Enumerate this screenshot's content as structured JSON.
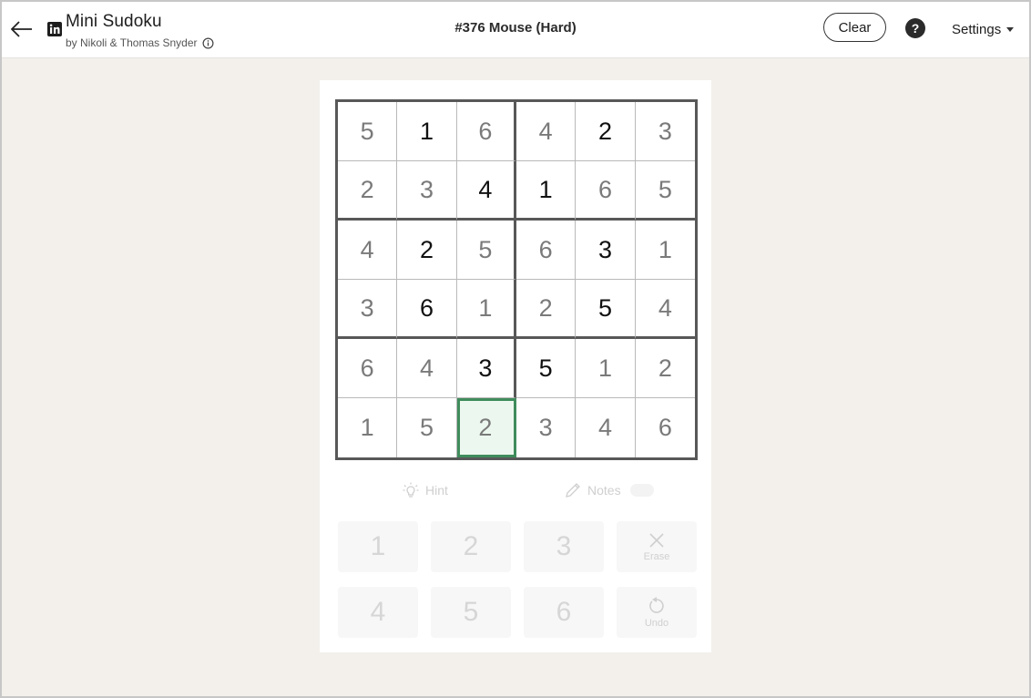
{
  "header": {
    "title": "Mini Sudoku",
    "byline": "by Nikoli & Thomas Snyder",
    "puzzle_title": "#376 Mouse (Hard)",
    "clear_label": "Clear",
    "help_label": "?",
    "settings_label": "Settings"
  },
  "board": {
    "rows": [
      [
        {
          "v": "5",
          "given": false
        },
        {
          "v": "1",
          "given": true
        },
        {
          "v": "6",
          "given": false
        },
        {
          "v": "4",
          "given": false
        },
        {
          "v": "2",
          "given": true
        },
        {
          "v": "3",
          "given": false
        }
      ],
      [
        {
          "v": "2",
          "given": false
        },
        {
          "v": "3",
          "given": false
        },
        {
          "v": "4",
          "given": true
        },
        {
          "v": "1",
          "given": true
        },
        {
          "v": "6",
          "given": false
        },
        {
          "v": "5",
          "given": false
        }
      ],
      [
        {
          "v": "4",
          "given": false
        },
        {
          "v": "2",
          "given": true
        },
        {
          "v": "5",
          "given": false
        },
        {
          "v": "6",
          "given": false
        },
        {
          "v": "3",
          "given": true
        },
        {
          "v": "1",
          "given": false
        }
      ],
      [
        {
          "v": "3",
          "given": false
        },
        {
          "v": "6",
          "given": true
        },
        {
          "v": "1",
          "given": false
        },
        {
          "v": "2",
          "given": false
        },
        {
          "v": "5",
          "given": true
        },
        {
          "v": "4",
          "given": false
        }
      ],
      [
        {
          "v": "6",
          "given": false
        },
        {
          "v": "4",
          "given": false
        },
        {
          "v": "3",
          "given": true
        },
        {
          "v": "5",
          "given": true
        },
        {
          "v": "1",
          "given": false
        },
        {
          "v": "2",
          "given": false
        }
      ],
      [
        {
          "v": "1",
          "given": false
        },
        {
          "v": "5",
          "given": false
        },
        {
          "v": "2",
          "given": false
        },
        {
          "v": "3",
          "given": false
        },
        {
          "v": "4",
          "given": false
        },
        {
          "v": "6",
          "given": false
        }
      ]
    ],
    "selected": {
      "row": 5,
      "col": 2
    },
    "colors": {
      "given": "#111111",
      "filled": "#7a7a7a",
      "selected_border": "#3f8c5c",
      "selected_bg": "#ecf8ef"
    }
  },
  "tools": {
    "hint_label": "Hint",
    "hint_icon": "lightbulb-icon",
    "notes_label": "Notes",
    "notes_icon": "pencil-icon"
  },
  "keypad": {
    "k1": "1",
    "k2": "2",
    "k3": "3",
    "k4": "4",
    "k5": "5",
    "k6": "6",
    "erase_label": "Erase",
    "erase_icon": "close-icon",
    "undo_label": "Undo",
    "undo_icon": "undo-icon"
  }
}
